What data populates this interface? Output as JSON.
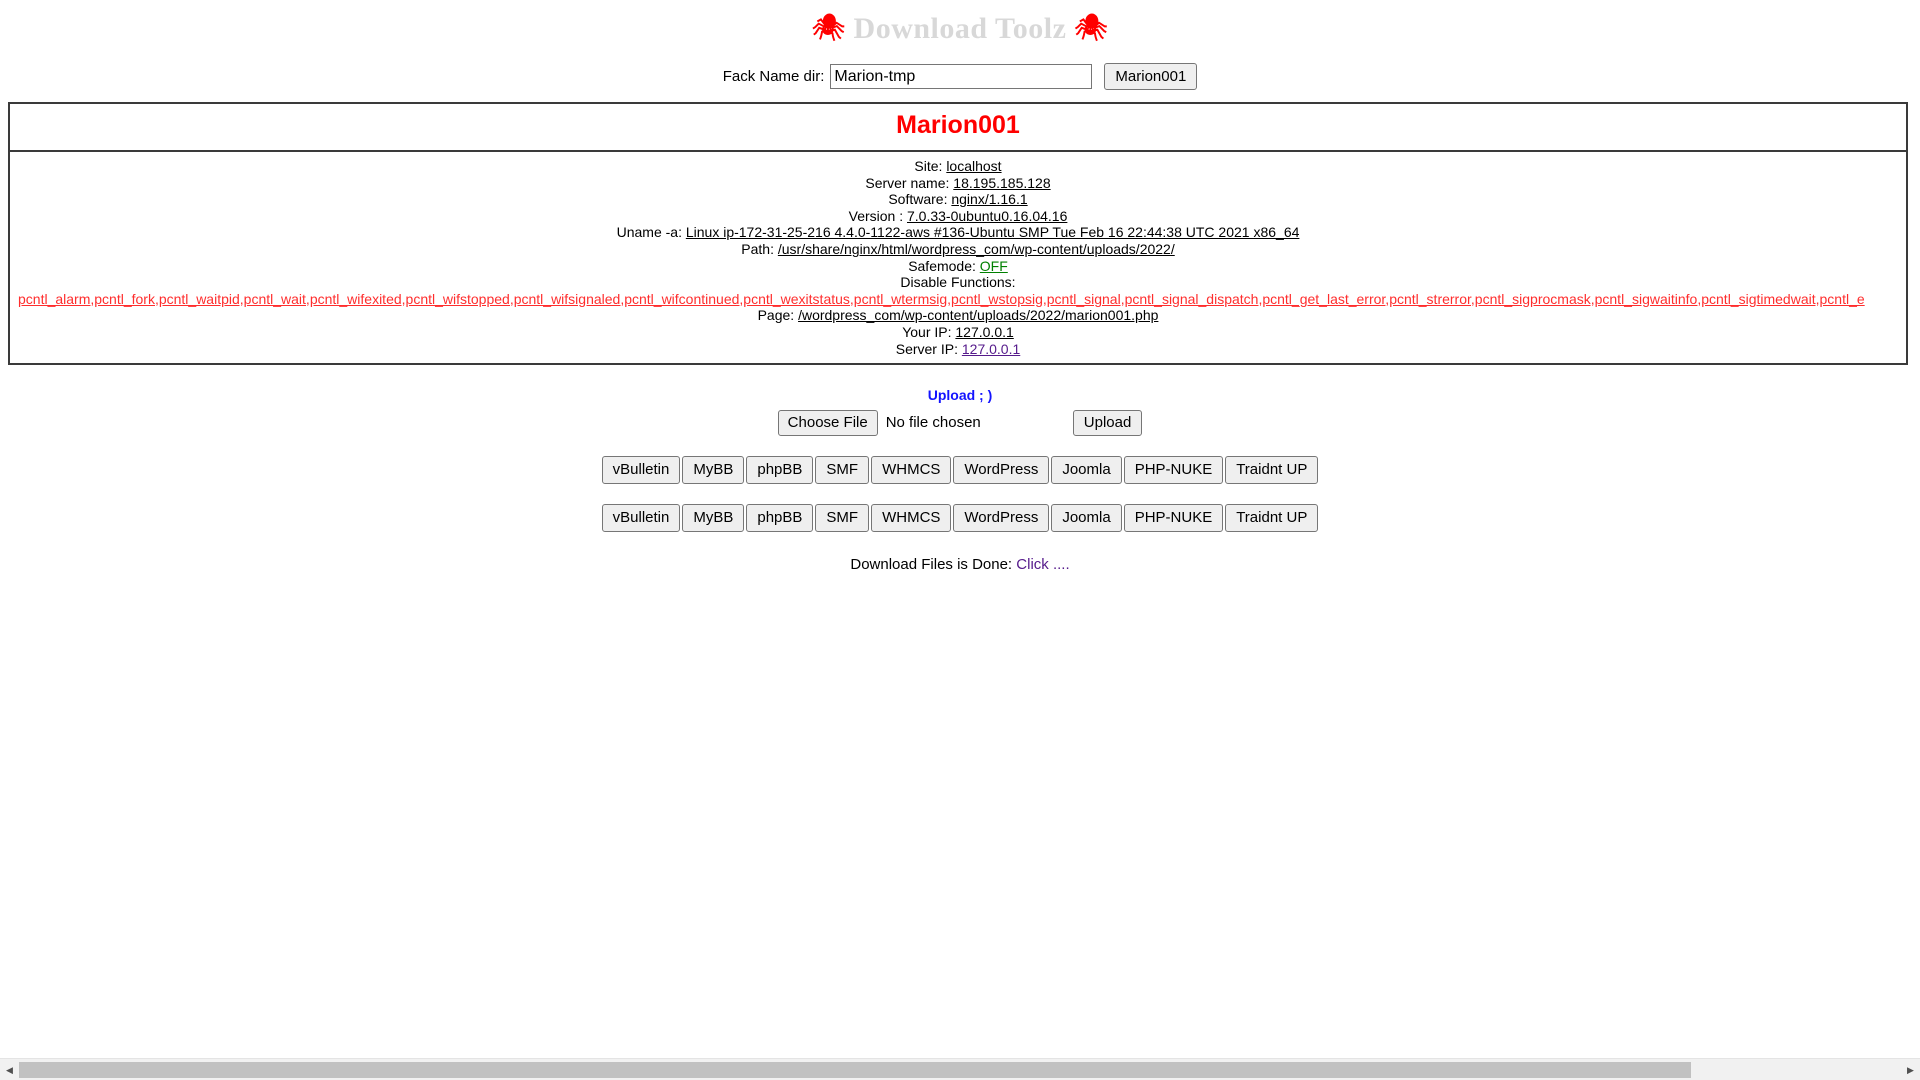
{
  "header": {
    "brand_title": "Download Toolz",
    "spider_icon": "🕷"
  },
  "fack_form": {
    "label": "Fack Name dir:",
    "input_value": "Marion-tmp",
    "input_placeholder": "",
    "submit_label": "Marion001"
  },
  "info_panel": {
    "title": "Marion001",
    "rows": [
      {
        "label": "Site:",
        "value": "localhost"
      },
      {
        "label": "Server name:",
        "value": "18.195.185.128"
      },
      {
        "label": "Software:",
        "value": "nginx/1.16.1"
      },
      {
        "label": "Version :",
        "value": "7.0.33-0ubuntu0.16.04.16"
      },
      {
        "label": "Uname -a:",
        "value": "Linux ip-172-31-25-216 4.4.0-1122-aws #136-Ubuntu SMP Tue Feb 16 22:44:38 UTC 2021 x86_64"
      },
      {
        "label": "Path:",
        "value": "/usr/share/nginx/html/wordpress_com/wp-content/uploads/2022/"
      }
    ],
    "safemode_label": "Safemode:",
    "safemode_value": "OFF",
    "disable_functions_label": "Disable Functions:",
    "disable_functions_value": "pcntl_alarm,pcntl_fork,pcntl_waitpid,pcntl_wait,pcntl_wifexited,pcntl_wifstopped,pcntl_wifsignaled,pcntl_wifcontinued,pcntl_wexitstatus,pcntl_wtermsig,pcntl_wstopsig,pcntl_signal,pcntl_signal_dispatch,pcntl_get_last_error,pcntl_strerror,pcntl_sigprocmask,pcntl_sigwaitinfo,pcntl_sigtimedwait,pcntl_e",
    "page_label": "Page:",
    "page_value": "/wordpress_com/wp-content/uploads/2022/marion001.php",
    "your_ip_label": "Your IP:",
    "your_ip_value": "127.0.0.1",
    "server_ip_label": "Server IP:",
    "server_ip_value": "127.0.0.1",
    "title_color": "#ff0000",
    "safemode_color": "#008000",
    "disable_color": "#ff2d2d",
    "visited_link_color": "#551a8b"
  },
  "upload": {
    "title": "Upload ; )",
    "title_color": "#1313ff",
    "choose_file_label": "Choose File",
    "file_status": "No file chosen",
    "upload_button_label": "Upload"
  },
  "script_buttons_row1": [
    "vBulletin",
    "MyBB",
    "phpBB",
    "SMF",
    "WHMCS",
    "WordPress",
    "Joomla",
    "PHP-NUKE",
    "Traidnt UP"
  ],
  "script_buttons_row2": [
    "vBulletin",
    "MyBB",
    "phpBB",
    "SMF",
    "WHMCS",
    "WordPress",
    "Joomla",
    "PHP-NUKE",
    "Traidnt UP"
  ],
  "status": {
    "done_text": "Download Files is Done:",
    "done_link": "Click ...."
  },
  "scrollbar": {
    "left_arrow_icon": "◀",
    "right_arrow_icon": "▶"
  }
}
